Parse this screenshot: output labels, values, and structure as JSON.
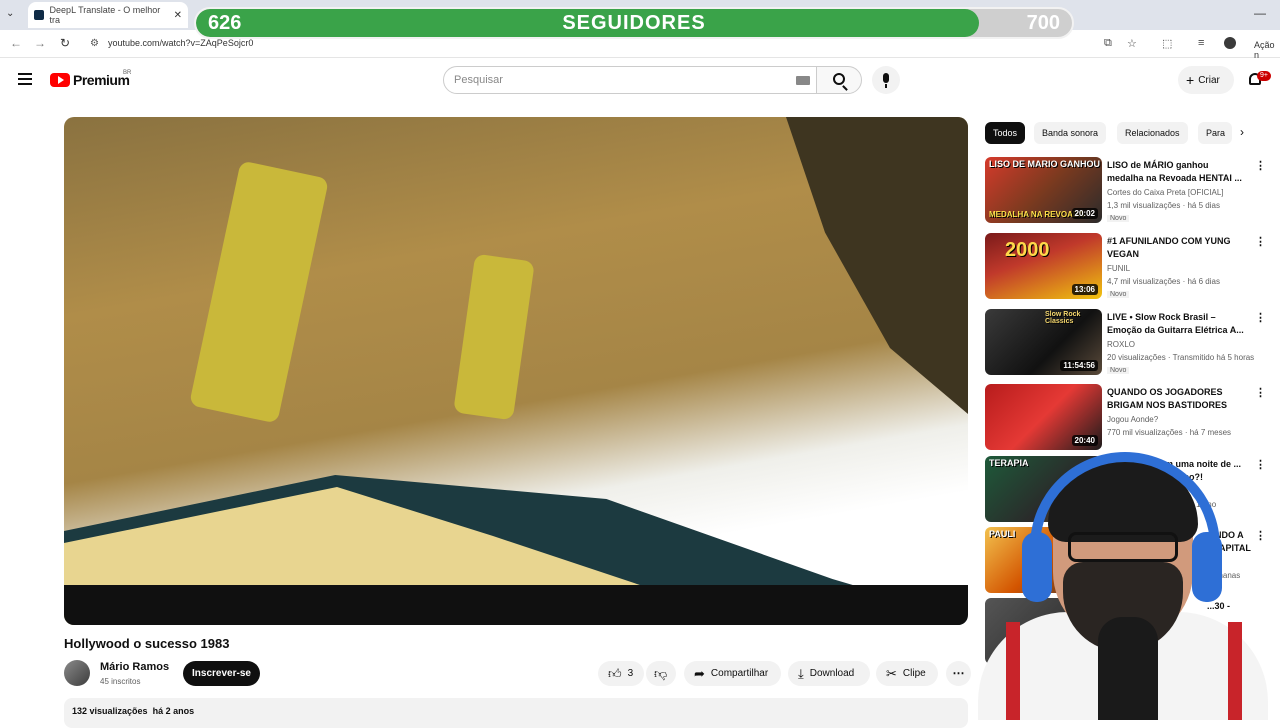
{
  "browser": {
    "tab_title": "DeepL Translate - O melhor tra",
    "url": "youtube.com/watch?v=ZAqPeSojcr0",
    "action_label": "Ação n"
  },
  "goal_bar": {
    "current": "626",
    "title": "SEGUIDORES",
    "target": "700",
    "progress_fraction": 0.8944,
    "fill_color": "#3aa349"
  },
  "header": {
    "logo": "Premium",
    "country": "BR",
    "search_placeholder": "Pesquisar",
    "create_label": "Criar",
    "notifications_badge": "9+"
  },
  "video": {
    "title": "Hollywood o sucesso 1983",
    "channel": "Mário Ramos",
    "subscribers": "45 inscritos",
    "subscribe_label": "Inscrever-se",
    "likes": "3",
    "share_label": "Compartilhar",
    "download_label": "Download",
    "clip_label": "Clipe",
    "views": "132 visualizações",
    "age": "há 2 anos"
  },
  "chips": [
    "Todos",
    "Banda sonora",
    "Relacionados",
    "Para"
  ],
  "recommendations": [
    {
      "title": "LISO de MÁRIO ganhou medalha na Revoada HENTAI ...",
      "channel": "Cortes do Caixa Preta [OFICIAL]",
      "meta": "1,3 mil visualizações · há 5 dias",
      "duration": "20:02",
      "badge": "Novo",
      "thumb_top": "LISO DE MARIO GANHOU",
      "thumb_bottom": "MEDALHA NA REVOADA"
    },
    {
      "title": "#1 AFUNILANDO COM YUNG VEGAN",
      "channel": "FUNIL",
      "meta": "4,7 mil visualizações · há 6 dias",
      "duration": "13:06",
      "badge": "Novo",
      "thumb_top": "2000"
    },
    {
      "title": "LIVE • Slow Rock Brasil – Emoção da Guitarra Elétrica A...",
      "channel": "ROXLO",
      "meta": "20 visualizações · Transmitido há 5 horas",
      "duration": "11:54:56",
      "badge": "Novo",
      "thumb_top": "Slow Rock Classics"
    },
    {
      "title": "QUANDO OS JOGADORES BRIGAM NOS BASTIDORES",
      "channel": "Jogou Aonde?",
      "meta": "770 mil visualizações · há 7 meses",
      "duration": "20:40",
      "badge": ""
    },
    {
      "title": "... em uma noite de ... está louco?!",
      "channel": "",
      "meta": "há 1 ano",
      "duration": "",
      "badge": "",
      "thumb_top": "TERAPIA"
    },
    {
      "title": "...INDO A ...CAPITAL ...",
      "channel": "",
      "meta": "há 2 semanas",
      "duration": "",
      "badge": "",
      "thumb_top": "PAULI"
    },
    {
      "title": "...30 -",
      "channel": "",
      "meta": "",
      "duration": "",
      "badge": ""
    }
  ]
}
